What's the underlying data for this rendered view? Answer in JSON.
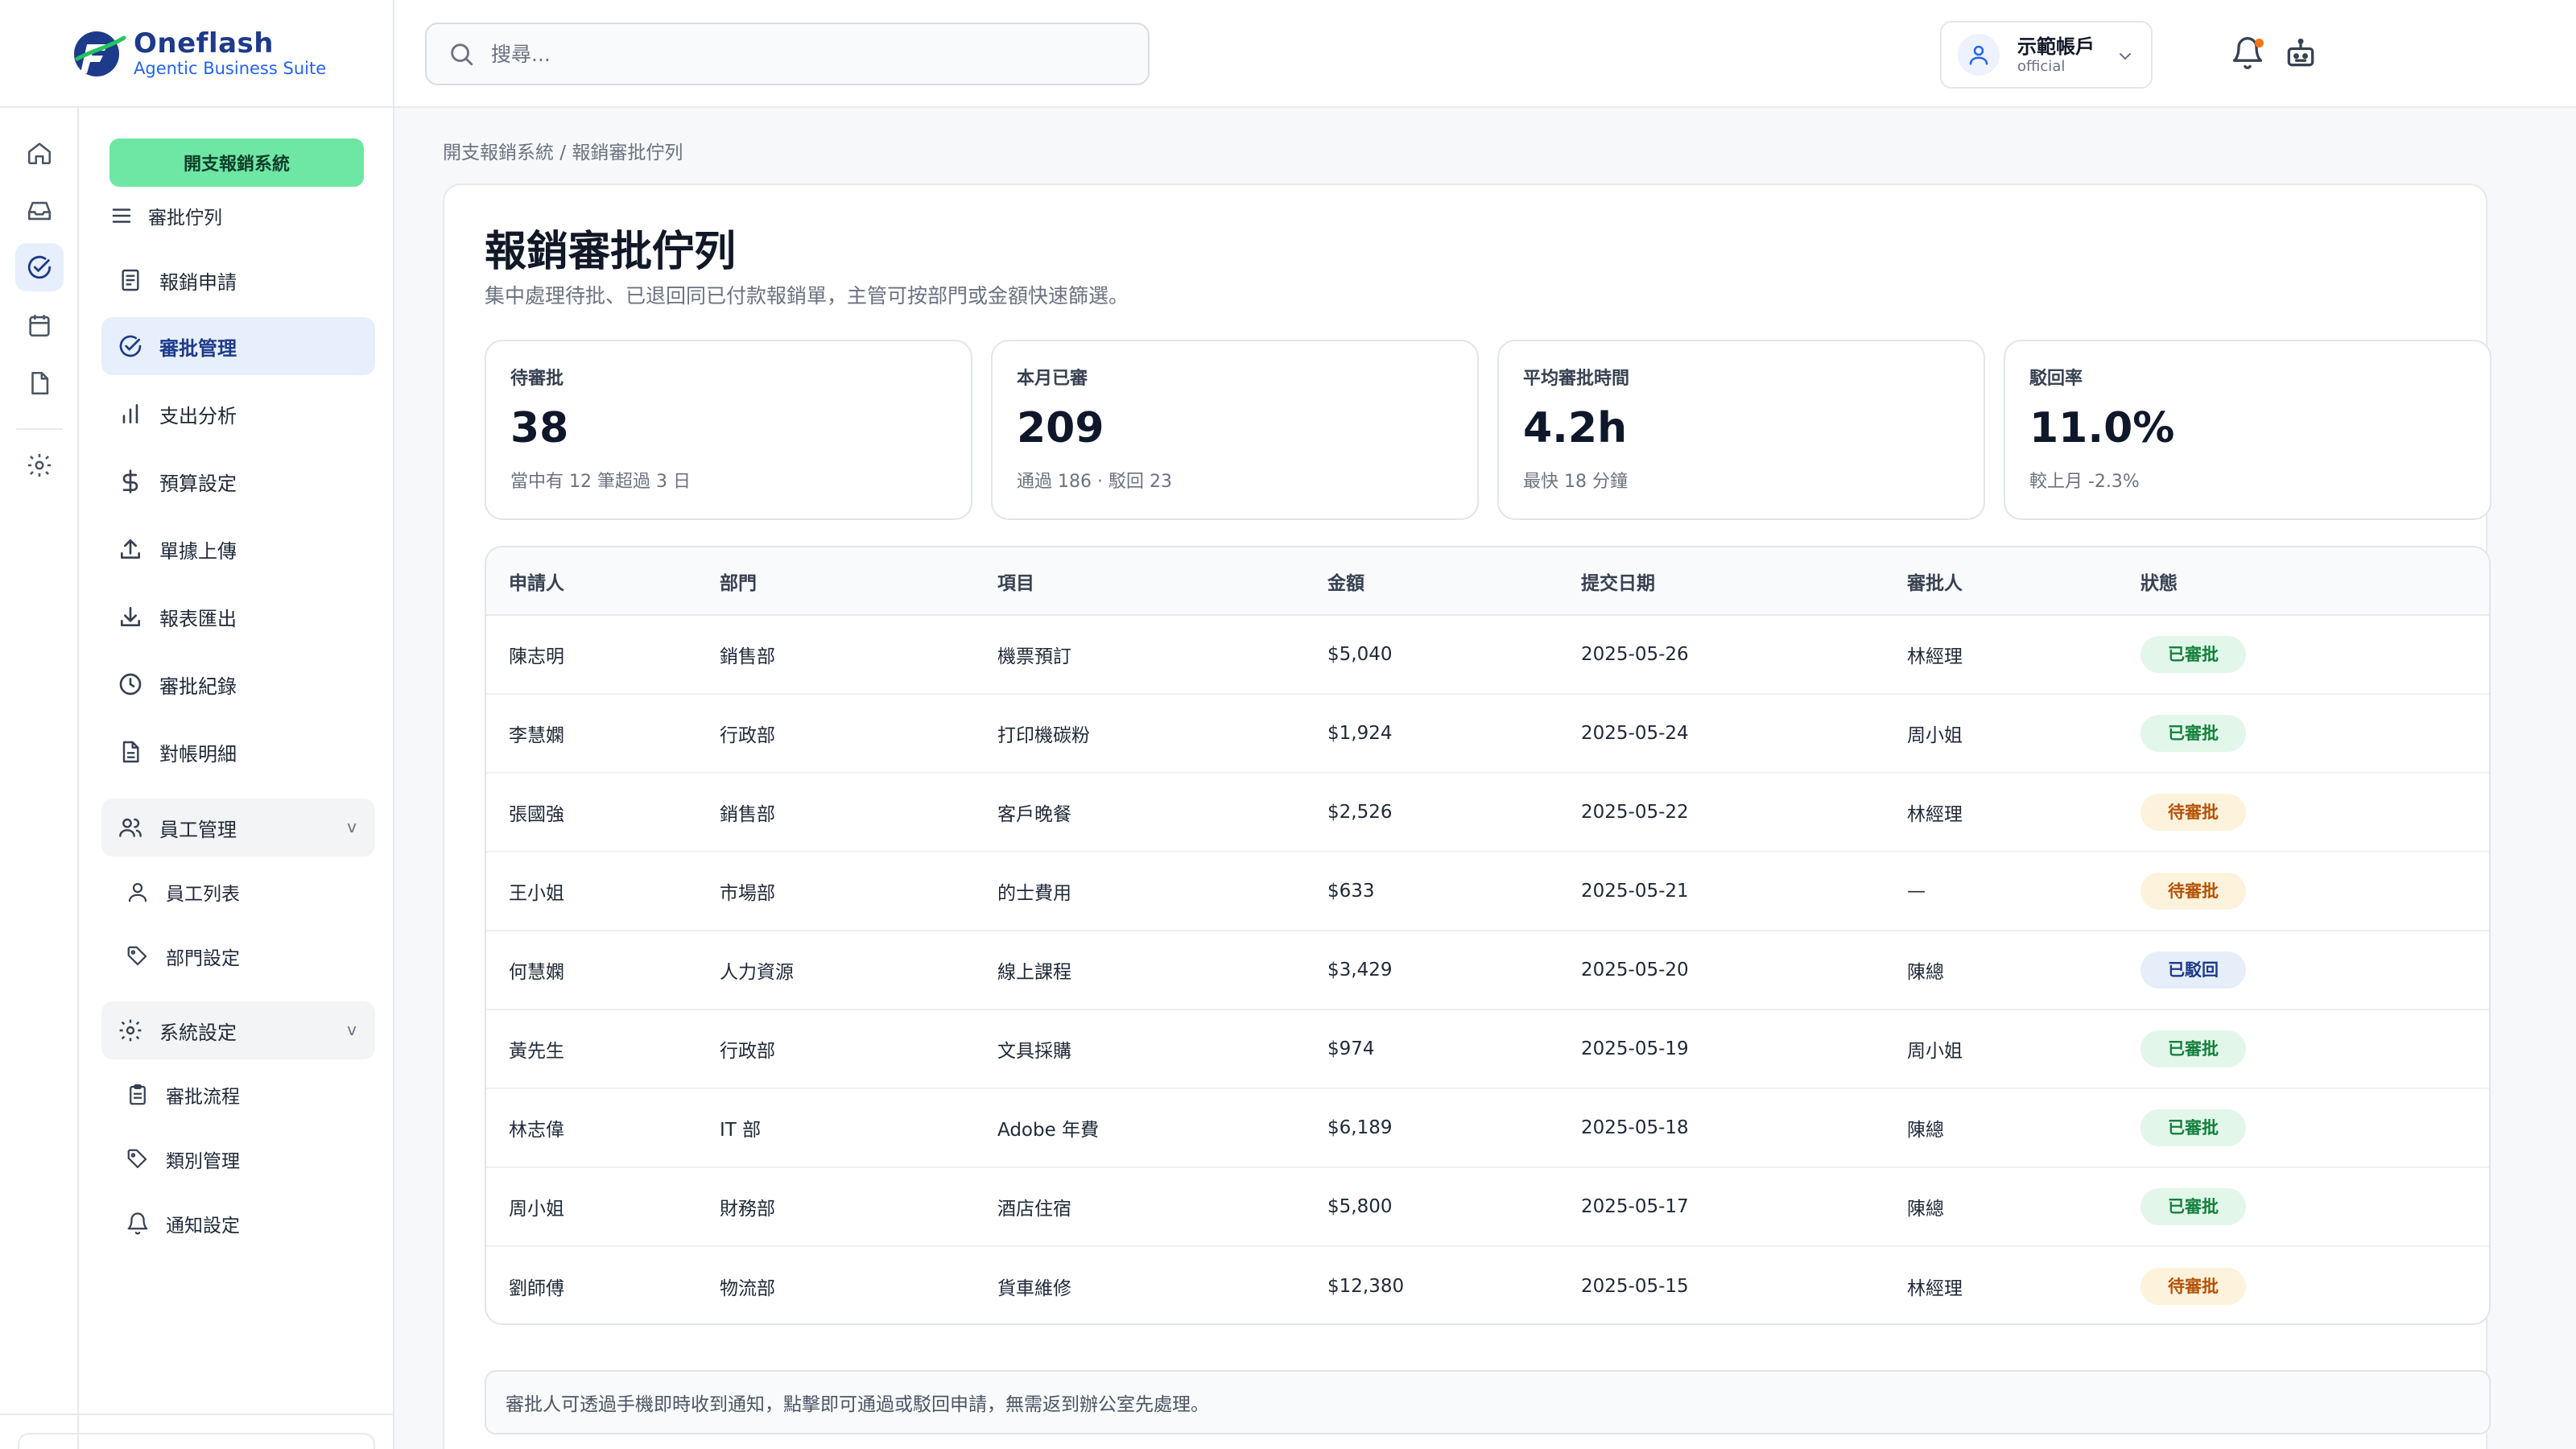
{
  "brand": {
    "name": "Oneflash",
    "tagline": "Agentic Business Suite"
  },
  "search": {
    "placeholder": "搜尋..."
  },
  "account": {
    "name": "示範帳戶",
    "role": "official"
  },
  "sidebar": {
    "cta_label": "開支報銷系統",
    "section_label": "審批佇列",
    "items": [
      {
        "label": "報銷申請",
        "icon": "document-icon"
      },
      {
        "label": "審批管理",
        "icon": "check-circle-icon"
      },
      {
        "label": "支出分析",
        "icon": "bar-chart-icon"
      },
      {
        "label": "預算設定",
        "icon": "dollar-icon"
      },
      {
        "label": "單據上傳",
        "icon": "upload-icon"
      },
      {
        "label": "報表匯出",
        "icon": "download-icon"
      },
      {
        "label": "審批紀錄",
        "icon": "clock-icon"
      },
      {
        "label": "對帳明細",
        "icon": "file-text-icon"
      }
    ],
    "groups": [
      {
        "label": "員工管理",
        "chevron": "v",
        "children": [
          {
            "label": "員工列表"
          },
          {
            "label": "部門設定"
          }
        ]
      },
      {
        "label": "系統設定",
        "chevron": "v",
        "children": [
          {
            "label": "審批流程"
          },
          {
            "label": "類別管理"
          },
          {
            "label": "通知設定"
          }
        ]
      }
    ]
  },
  "breadcrumb": "開支報銷系統 / 報銷審批佇列",
  "page": {
    "title": "報銷審批佇列",
    "subtitle": "集中處理待批、已退回同已付款報銷單，主管可按部門或金額快速篩選。"
  },
  "stats": [
    {
      "label": "待審批",
      "value": "38",
      "note": "當中有 12 筆超過 3 日"
    },
    {
      "label": "本月已審",
      "value": "209",
      "note": "通過 186 · 駁回 23"
    },
    {
      "label": "平均審批時間",
      "value": "4.2h",
      "note": "最快 18 分鐘"
    },
    {
      "label": "駁回率",
      "value": "11.0%",
      "note": "較上月 -2.3%"
    }
  ],
  "table": {
    "headers": [
      "申請人",
      "部門",
      "項目",
      "金額",
      "提交日期",
      "審批人",
      "狀態"
    ],
    "rows": [
      [
        "陳志明",
        "銷售部",
        "機票預訂",
        "$5,040",
        "2025-05-26",
        "林經理",
        "已審批"
      ],
      [
        "李慧嫻",
        "行政部",
        "打印機碳粉",
        "$1,924",
        "2025-05-24",
        "周小姐",
        "已審批"
      ],
      [
        "張國強",
        "銷售部",
        "客戶晚餐",
        "$2,526",
        "2025-05-22",
        "林經理",
        "待審批"
      ],
      [
        "王小姐",
        "市場部",
        "的士費用",
        "$633",
        "2025-05-21",
        "—",
        "待審批"
      ],
      [
        "何慧嫻",
        "人力資源",
        "線上課程",
        "$3,429",
        "2025-05-20",
        "陳總",
        "已駁回"
      ],
      [
        "黃先生",
        "行政部",
        "文具採購",
        "$974",
        "2025-05-19",
        "周小姐",
        "已審批"
      ],
      [
        "林志偉",
        "IT 部",
        "Adobe 年費",
        "$6,189",
        "2025-05-18",
        "陳總",
        "已審批"
      ],
      [
        "周小姐",
        "財務部",
        "酒店住宿",
        "$5,800",
        "2025-05-17",
        "陳總",
        "已審批"
      ],
      [
        "劉師傅",
        "物流部",
        "貨車維修",
        "$12,380",
        "2025-05-15",
        "林經理",
        "待審批"
      ]
    ]
  },
  "footnote": "審批人可透過手機即時收到通知，點擊即可通過或駁回申請，無需返到辦公室先處理。",
  "colors": {
    "brand": "#1e3a8a",
    "cta": "#6ee7a4",
    "approved": "#15803d",
    "pending": "#b45309",
    "rejected": "#1e3a8a"
  }
}
